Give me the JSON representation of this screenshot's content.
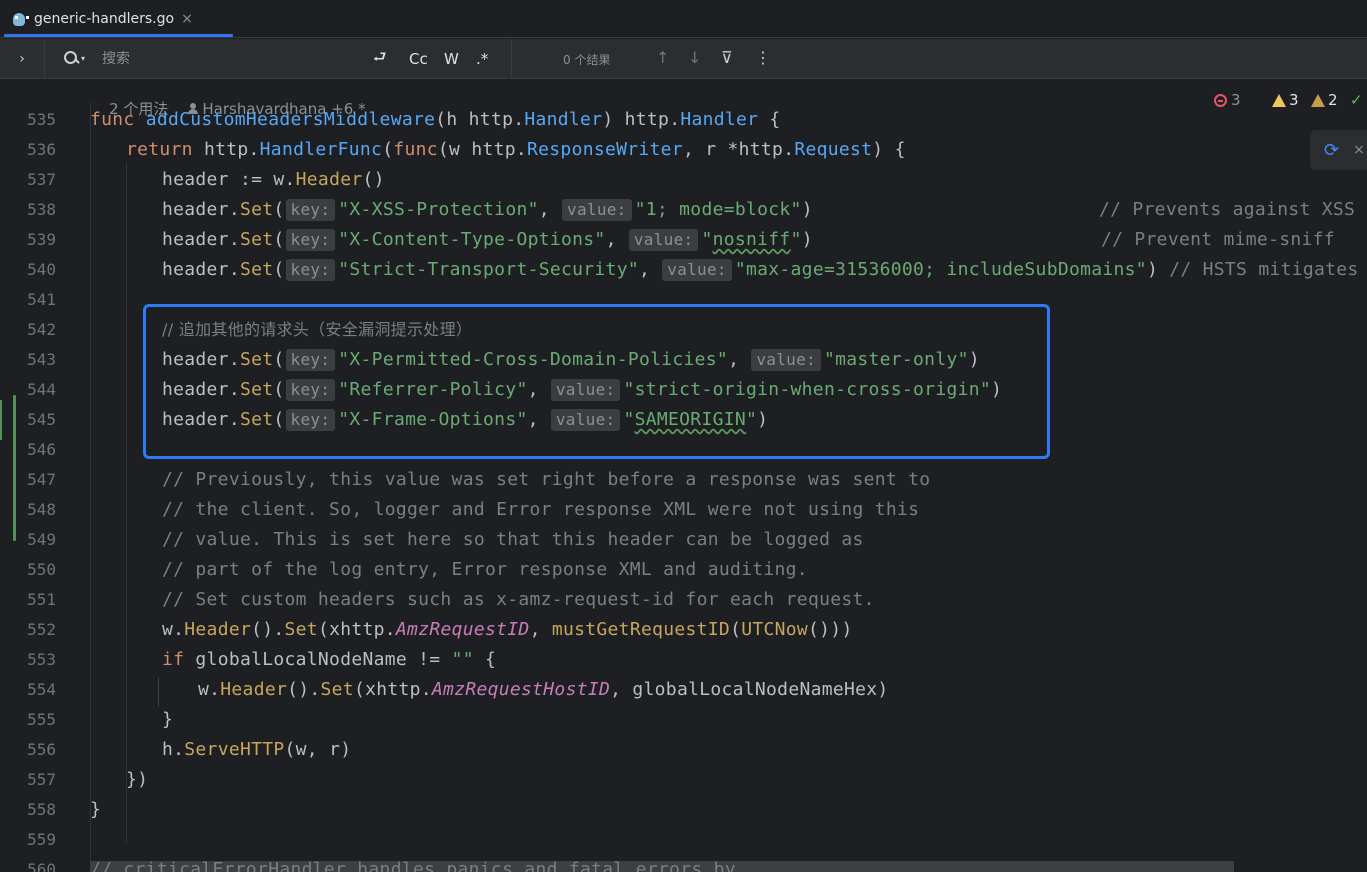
{
  "tab": {
    "filename": "generic-handlers.go",
    "close": "×"
  },
  "search": {
    "expand": "›",
    "placeholder": "搜索",
    "options": {
      "regex_replace": "⮐",
      "match_case": "Cc",
      "words": "W",
      "regex": ".*"
    },
    "results": "0 个结果",
    "prev": "↑",
    "next": "↓",
    "filter": "⊽",
    "more": "⋮"
  },
  "meta": {
    "usages": "2 个用法",
    "authors": "Harshavardhana +6 *"
  },
  "inspections": {
    "errors": "3",
    "warnings": "3",
    "weak_warnings": "2"
  },
  "code": {
    "l535": {
      "kw": "func ",
      "name": "addCustomHeadersMiddleware",
      "p1": "(h ",
      "pkg": "http",
      "dot": ".",
      "ty": "Handler",
      "p2": ") ",
      "pkg2": "http",
      "dot2": ".",
      "ty2": "Handler",
      "p3": " {"
    },
    "l536": {
      "kw": "return ",
      "pkg": "http",
      "fn": "HandlerFunc",
      "p1": "(",
      "kw2": "func",
      "p2": "(w ",
      "pkg2": "http",
      "ty": "ResponseWriter",
      "p3": ", r *",
      "pkg3": "http",
      "ty2": "Request",
      "p4": ") {"
    },
    "l537": {
      "a": "header := w.",
      "call": "Header",
      "b": "()"
    },
    "header_set": "header.",
    "set": "Set",
    "key_hint": "key:",
    "value_hint": "value:",
    "l538": {
      "key": "\"X-XSS-Protection\"",
      "value": "\"1; mode=block\"",
      "comment": "// Prevents against XSS a"
    },
    "l539": {
      "key": "\"X-Content-Type-Options\"",
      "value_q": "\"",
      "value": "nosniff",
      "value_q2": "\"",
      "comment": "// Prevent mime-sniff"
    },
    "l540": {
      "key": "\"Strict-Transport-Security\"",
      "value": "\"max-age=31536000; includeSubDomains\"",
      "comment": "// HSTS mitigates ve"
    },
    "l542": "// 追加其他的请求头（安全漏洞提示处理）",
    "l543": {
      "key": "\"X-Permitted-Cross-Domain-Policies\"",
      "value": "\"master-only\""
    },
    "l544": {
      "key": "\"Referrer-Policy\"",
      "value": "\"strict-origin-when-cross-origin\""
    },
    "l545": {
      "key": "\"X-Frame-Options\"",
      "value_q": "\"",
      "value": "SAMEORIGIN",
      "value_q2": "\""
    },
    "l547": "// Previously, this value was set right before a response was sent to",
    "l548": "// the client. So, logger and Error response XML were not using this",
    "l549": "// value. This is set here so that this header can be logged as",
    "l550": "// part of the log entry, Error response XML and auditing.",
    "l551": "// Set custom headers such as x-amz-request-id for each request.",
    "l552": {
      "a": "w.",
      "c1": "Header",
      "b": "().",
      "c2": "Set",
      "c": "(xhttp.",
      "const": "AmzRequestID",
      "d": ", ",
      "c3": "mustGetRequestID",
      "e": "(",
      "c4": "UTCNow",
      "f": "()))"
    },
    "l553": {
      "kw": "if",
      "a": " globalLocalNodeName != ",
      "str": "\"\"",
      "b": " {"
    },
    "l554": {
      "a": "w.",
      "c1": "Header",
      "b": "().",
      "c2": "Set",
      "c": "(xhttp.",
      "const": "AmzRequestHostID",
      "d": ", globalLocalNodeNameHex)"
    },
    "l555": "}",
    "l556": {
      "a": "h.",
      "call": "ServeHTTP",
      "b": "(w, r)"
    },
    "l557": "})",
    "l558": "}",
    "l560": "// criticalErrorHandler handles panics and fatal errors by"
  },
  "line_numbers": [
    "535",
    "536",
    "537",
    "538",
    "539",
    "540",
    "541",
    "542",
    "543",
    "544",
    "545",
    "546",
    "547",
    "548",
    "549",
    "550",
    "551",
    "552",
    "553",
    "554",
    "555",
    "556",
    "557",
    "558",
    "559",
    "560"
  ],
  "sync": {
    "icon": "⟳",
    "close": "×"
  }
}
